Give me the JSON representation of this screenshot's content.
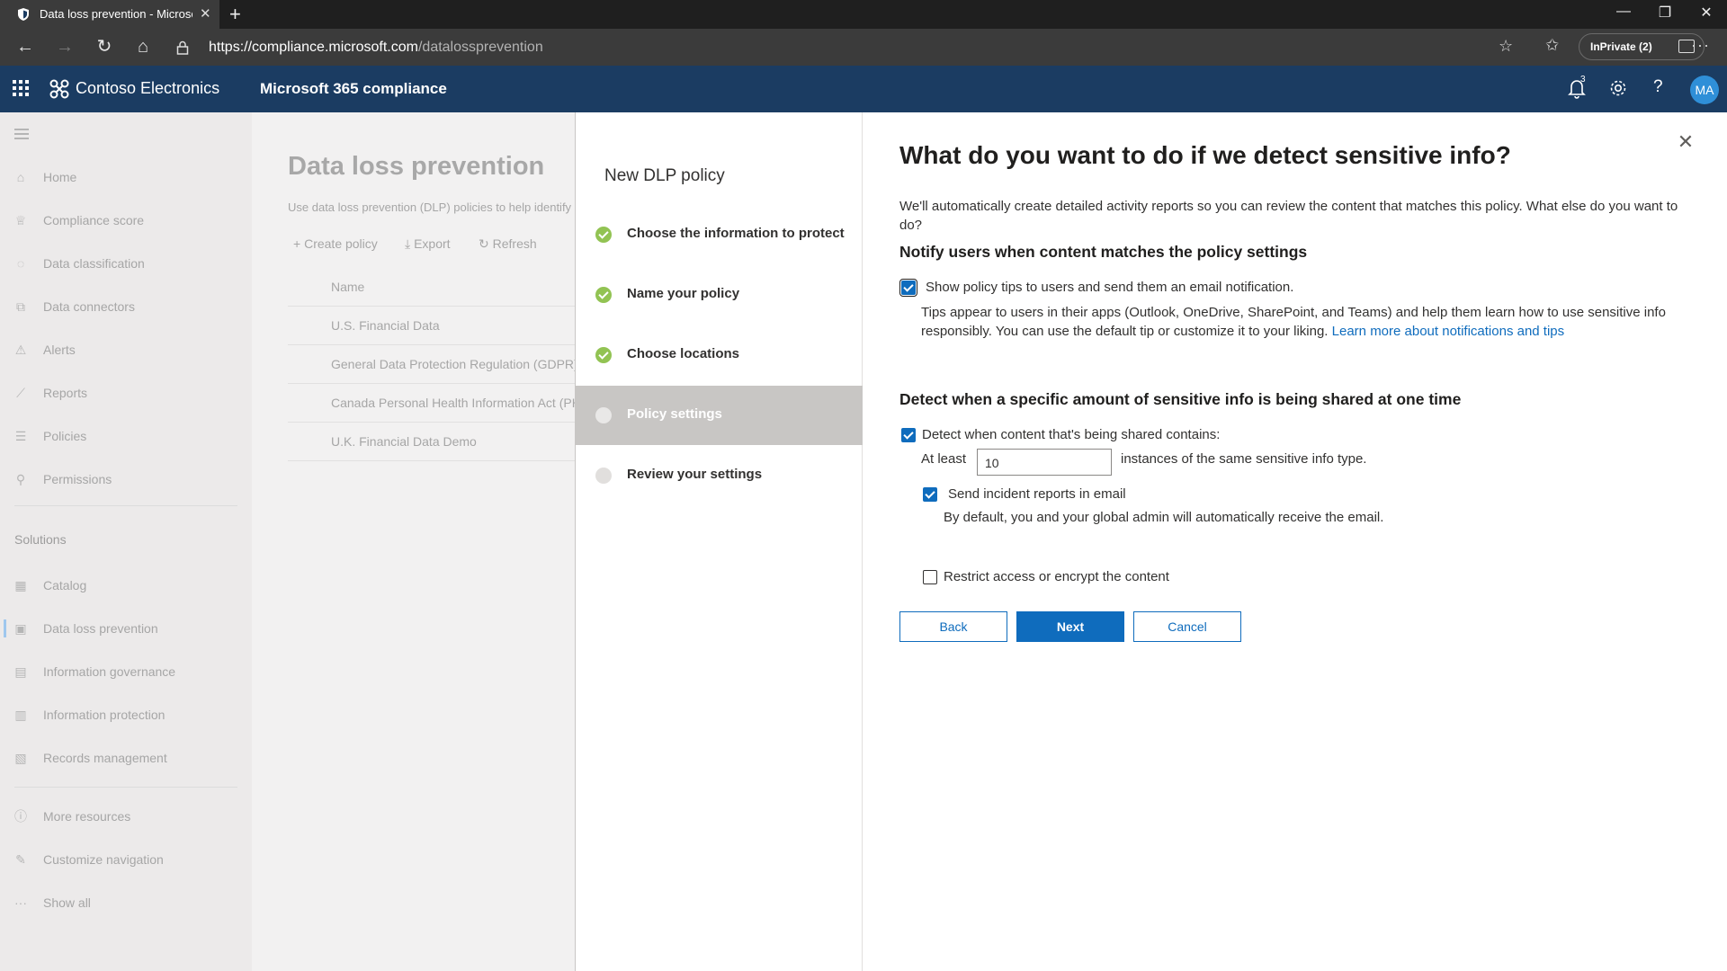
{
  "browser": {
    "tab_title": "Data loss prevention - Microsoft",
    "url_host": "https://compliance.microsoft.com",
    "url_path": "/datalossprevention",
    "inprivate_label": "InPrivate (2)"
  },
  "suite": {
    "org_name": "Contoso Electronics",
    "app_name": "Microsoft 365 compliance",
    "notification_count": "3",
    "avatar_initials": "MA"
  },
  "leftnav": {
    "items": [
      {
        "label": "Home",
        "icon": "home-icon"
      },
      {
        "label": "Compliance score",
        "icon": "trophy-icon"
      },
      {
        "label": "Data classification",
        "icon": "classification-icon"
      },
      {
        "label": "Data connectors",
        "icon": "connector-icon"
      },
      {
        "label": "Alerts",
        "icon": "alert-icon"
      },
      {
        "label": "Reports",
        "icon": "chart-icon"
      },
      {
        "label": "Policies",
        "icon": "sliders-icon"
      },
      {
        "label": "Permissions",
        "icon": "key-icon"
      }
    ],
    "section_label": "Solutions",
    "solutions": [
      {
        "label": "Catalog",
        "icon": "grid-icon"
      },
      {
        "label": "Data loss prevention",
        "icon": "shield-doc-icon"
      },
      {
        "label": "Information governance",
        "icon": "archive-icon"
      },
      {
        "label": "Information protection",
        "icon": "lock-doc-icon"
      },
      {
        "label": "Records management",
        "icon": "records-icon"
      }
    ],
    "footer": [
      {
        "label": "More resources",
        "icon": "info-icon"
      },
      {
        "label": "Customize navigation",
        "icon": "pencil-icon"
      },
      {
        "label": "Show all",
        "icon": "ellipsis-icon"
      }
    ]
  },
  "bgpage": {
    "title": "Data loss prevention",
    "description": "Use data loss prevention (DLP) policies to help identify",
    "commands": {
      "create": "Create policy",
      "export": "Export",
      "refresh": "Refresh"
    },
    "column_name": "Name",
    "rows": [
      "U.S. Financial Data",
      "General Data Protection Regulation (GDPR)",
      "Canada Personal Health Information Act (PHIA)",
      "U.K. Financial Data Demo"
    ]
  },
  "wizard": {
    "title": "New DLP policy",
    "steps": [
      {
        "label": "Choose the information to protect",
        "status": "done"
      },
      {
        "label": "Name your policy",
        "status": "done"
      },
      {
        "label": "Choose locations",
        "status": "done"
      },
      {
        "label": "Policy settings",
        "status": "current"
      },
      {
        "label": "Review your settings",
        "status": "todo"
      }
    ]
  },
  "content": {
    "title": "What do you want to do if we detect sensitive info?",
    "intro": "We'll automatically create detailed activity reports so you can review the content that matches this policy. What else do you want to do?",
    "notify_heading": "Notify users when content matches the policy settings",
    "show_tips_label": "Show policy tips to users and send them an email notification.",
    "show_tips_checked": true,
    "tips_description": "Tips appear to users in their apps (Outlook, OneDrive, SharePoint, and Teams) and help them learn how to use sensitive info responsibly. You can use the default tip or customize it to your liking.",
    "tips_link": "Learn more about notifications and tips",
    "detect_heading": "Detect when a specific amount of sensitive info is being shared at one time",
    "detect_label": "Detect when content that's being shared contains:",
    "detect_checked": true,
    "at_least_label": "At least",
    "instances_value": "10",
    "instances_suffix": "instances of the same sensitive info type.",
    "incident_label": "Send incident reports in email",
    "incident_checked": true,
    "incident_note": "By default, you and your global admin will automatically receive the email.",
    "restrict_label": "Restrict access or encrypt the content",
    "restrict_checked": false,
    "buttons": {
      "back": "Back",
      "next": "Next",
      "cancel": "Cancel"
    }
  },
  "colors": {
    "accent": "#0f6cbd",
    "suite_bar": "#1b3c62",
    "step_done": "#92c353"
  }
}
